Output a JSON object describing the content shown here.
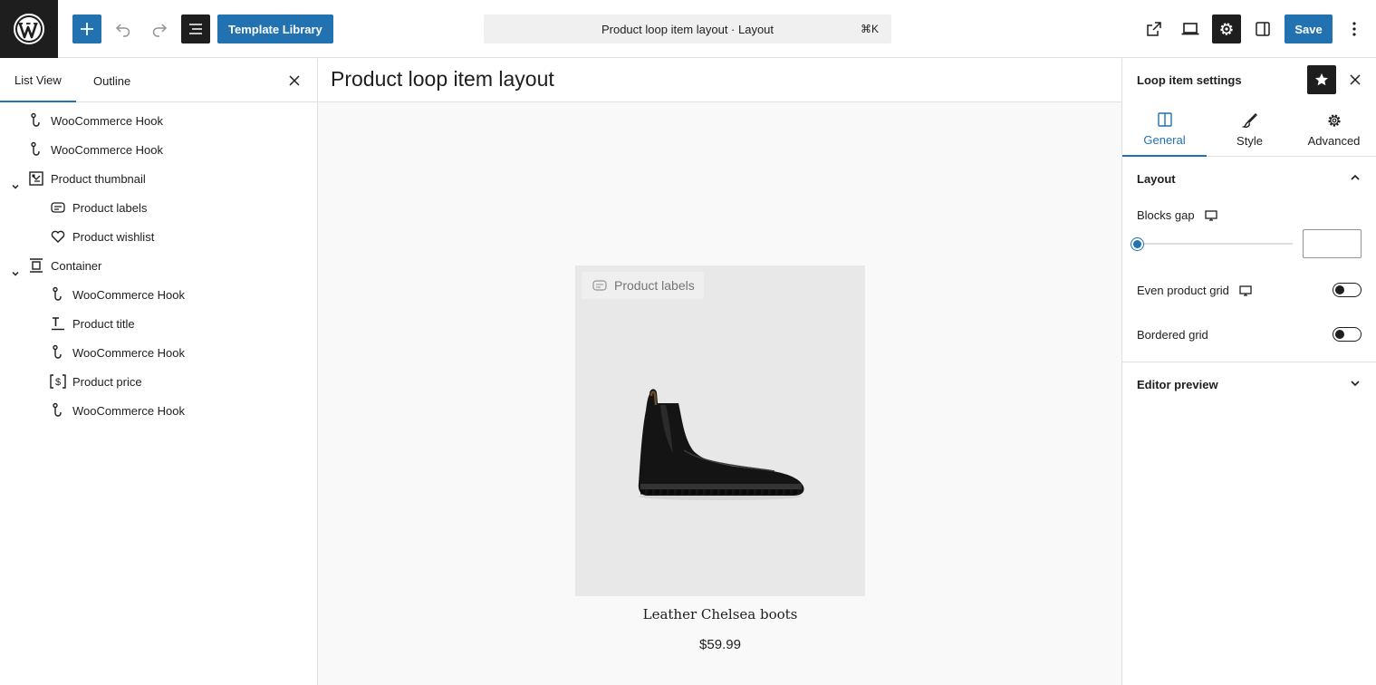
{
  "topbar": {
    "template_library_label": "Template Library",
    "document_title": "Product loop item layout · Layout",
    "shortcut": "⌘K",
    "save_label": "Save"
  },
  "list_panel": {
    "tabs": [
      "List View",
      "Outline"
    ],
    "items": [
      {
        "label": "WooCommerce Hook",
        "icon": "hook-icon",
        "depth": 0
      },
      {
        "label": "WooCommerce Hook",
        "icon": "hook-icon",
        "depth": 0
      },
      {
        "label": "Product thumbnail",
        "icon": "thumbnail-icon",
        "depth": 0,
        "expanded": true
      },
      {
        "label": "Product labels",
        "icon": "labels-icon",
        "depth": 1
      },
      {
        "label": "Product wishlist",
        "icon": "heart-icon",
        "depth": 1
      },
      {
        "label": "Container",
        "icon": "container-icon",
        "depth": 0,
        "expanded": true
      },
      {
        "label": "WooCommerce Hook",
        "icon": "hook-icon",
        "depth": 1
      },
      {
        "label": "Product title",
        "icon": "title-icon",
        "depth": 1
      },
      {
        "label": "WooCommerce Hook",
        "icon": "hook-icon",
        "depth": 1
      },
      {
        "label": "Product price",
        "icon": "price-icon",
        "depth": 1
      },
      {
        "label": "WooCommerce Hook",
        "icon": "hook-icon",
        "depth": 1
      }
    ]
  },
  "canvas": {
    "title": "Product loop item layout",
    "product_labels": "Product labels",
    "product_name": "Leather Chelsea boots",
    "product_price": "$59.99"
  },
  "settings": {
    "title": "Loop item settings",
    "tabs": [
      "General",
      "Style",
      "Advanced"
    ],
    "active_tab": "General",
    "layout_section": "Layout",
    "blocks_gap_label": "Blocks gap",
    "blocks_gap_value": "",
    "even_grid_label": "Even product grid",
    "even_grid_on": false,
    "bordered_grid_label": "Bordered grid",
    "bordered_grid_on": false,
    "editor_preview_section": "Editor preview"
  },
  "colors": {
    "accent": "#2271b1",
    "dark": "#1e1e1e",
    "border": "#e0e0e0"
  }
}
